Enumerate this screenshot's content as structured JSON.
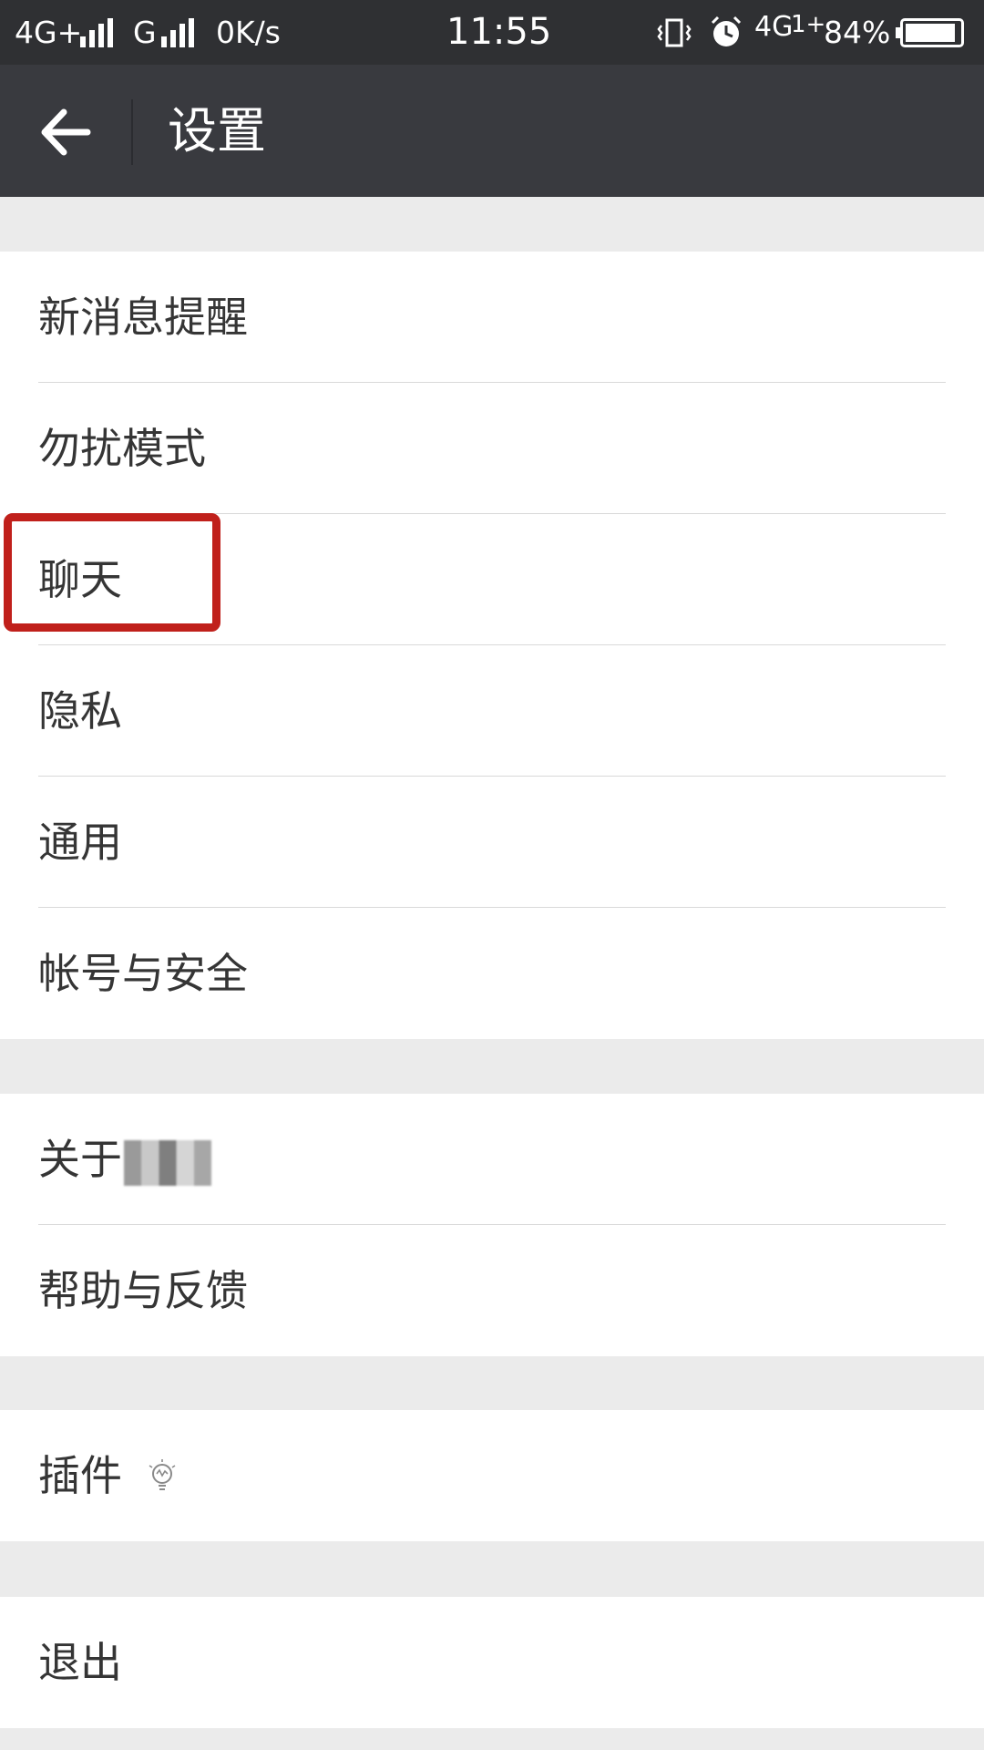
{
  "status_bar": {
    "network1": "4G+",
    "network2": "G",
    "speed": "0K/s",
    "time": "11:55",
    "network3": "4G",
    "network3_suffix": "1+",
    "battery_percent": "84%",
    "battery_level": 0.84,
    "icons": [
      "signal-icon",
      "signal-icon",
      "vibrate-icon",
      "alarm-icon",
      "battery-icon"
    ]
  },
  "header": {
    "back_icon": "back-arrow-icon",
    "title": "设置"
  },
  "groups": [
    {
      "items": [
        "新消息提醒",
        "勿扰模式",
        "聊天",
        "隐私",
        "通用",
        "帐号与安全"
      ]
    },
    {
      "items": [
        "关于",
        "帮助与反馈"
      ]
    },
    {
      "items": [
        "插件"
      ]
    },
    {
      "items": [
        "退出"
      ]
    }
  ],
  "highlight": {
    "target": "聊天",
    "color": "#c0201b"
  },
  "colors": {
    "status_bar_bg": "#2f3033",
    "title_bar_bg": "#393a3f",
    "page_bg": "#ebebeb",
    "row_bg": "#ffffff",
    "text": "#353535"
  }
}
